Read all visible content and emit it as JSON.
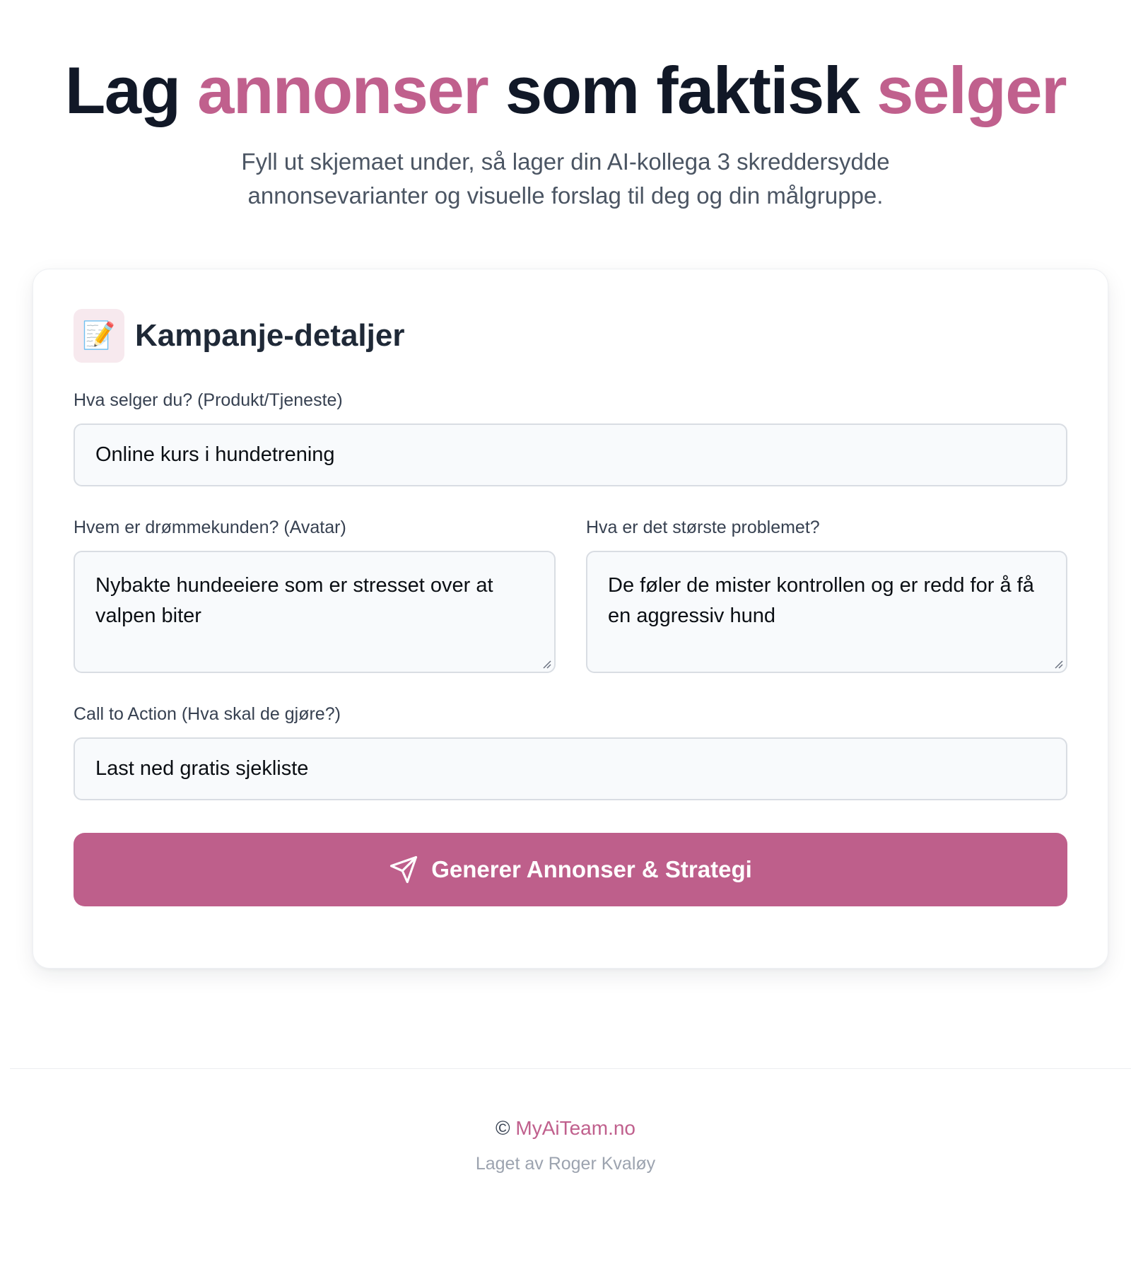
{
  "hero": {
    "title_part1": "Lag ",
    "title_accent1": "annonser",
    "title_part2": " som faktisk ",
    "title_accent2": "selger",
    "subtitle": "Fyll ut skjemaet under, så lager din AI-kollega 3 skreddersydde annonsevarianter og visuelle forslag til deg og din målgruppe."
  },
  "card": {
    "icon": "📝",
    "title": "Kampanje-detaljer"
  },
  "form": {
    "product": {
      "label": "Hva selger du? (Produkt/Tjeneste)",
      "value": "Online kurs i hundetrening"
    },
    "avatar": {
      "label": "Hvem er drømmekunden? (Avatar)",
      "value": "Nybakte hundeeiere som er stresset over at valpen biter"
    },
    "problem": {
      "label": "Hva er det største problemet?",
      "value": "De føler de mister kontrollen og er redd for å få en aggressiv hund"
    },
    "cta": {
      "label": "Call to Action (Hva skal de gjøre?)",
      "value": "Last ned gratis sjekliste"
    },
    "submit_label": "Generer Annonser & Strategi",
    "submit_icon": "send-icon"
  },
  "footer": {
    "copyright_symbol": "©",
    "brand": "MyAiTeam.no",
    "credit": "Laget av Roger Kvaløy"
  },
  "colors": {
    "accent": "#c0608d",
    "button": "#be5f8b",
    "heading": "#111827",
    "muted": "#4b5563"
  }
}
